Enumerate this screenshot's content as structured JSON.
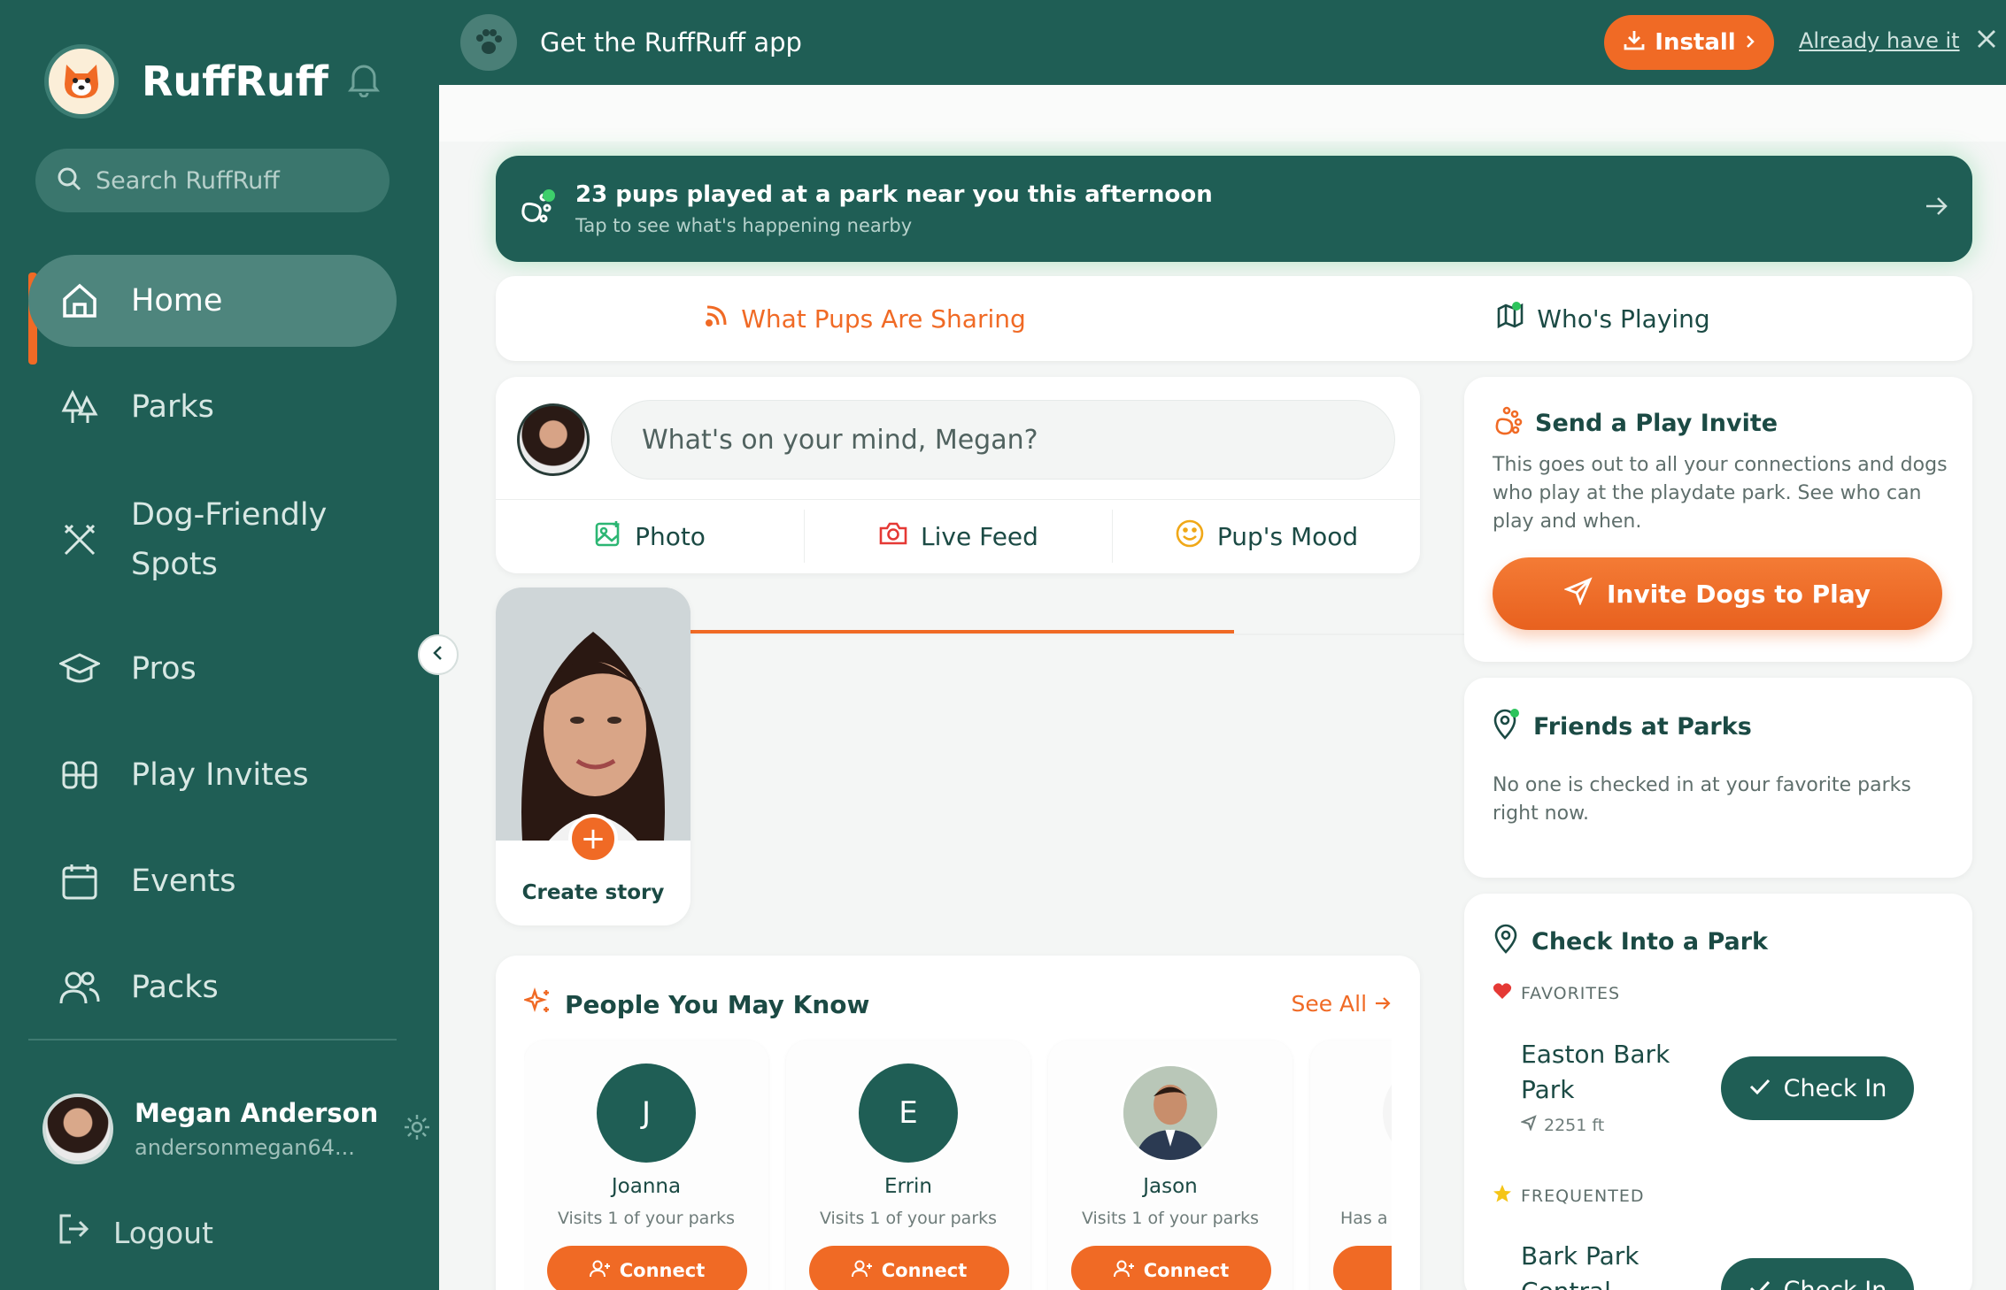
{
  "brand": {
    "name": "RuffRuff",
    "logo_icon": "dog-face-icon"
  },
  "search": {
    "placeholder": "Search RuffRuff"
  },
  "nav": [
    {
      "label": "Home",
      "icon": "home-icon",
      "active": true
    },
    {
      "label": "Parks",
      "icon": "trees-icon"
    },
    {
      "label_line1": "Dog-Friendly",
      "label_line2": "Spots",
      "icon": "utensils-icon"
    },
    {
      "label": "Pros",
      "icon": "graduation-cap-icon"
    },
    {
      "label": "Play Invites",
      "icon": "dogs-icon"
    },
    {
      "label": "Events",
      "icon": "calendar-icon"
    },
    {
      "label": "Packs",
      "icon": "users-icon"
    }
  ],
  "profile": {
    "name": "Megan Anderson",
    "email": "andersonmegan64..."
  },
  "logout_label": "Logout",
  "banner": {
    "text": "Get the RuffRuff app",
    "install": "Install",
    "already": "Already have it"
  },
  "alert": {
    "title": "23 pups played at a park near you this afternoon",
    "subtitle": "Tap to see what's happening nearby"
  },
  "tabs": {
    "sharing": "What Pups Are Sharing",
    "playing": "Who's Playing"
  },
  "composer": {
    "placeholder": "What's on your mind, Megan?",
    "photo": "Photo",
    "live": "Live Feed",
    "mood": "Pup's Mood"
  },
  "story": {
    "label": "Create story"
  },
  "pymk": {
    "title": "People You May Know",
    "see_all": "See All",
    "people": [
      {
        "initial": "J",
        "name": "Joanna",
        "sub": "Visits 1 of your parks",
        "button": "Connect"
      },
      {
        "initial": "E",
        "name": "Errin",
        "sub": "Visits 1 of your parks",
        "button": "Connect"
      },
      {
        "initial": "",
        "name": "Jason",
        "sub": "Visits 1 of your parks",
        "button": "Connect"
      },
      {
        "initial": "",
        "name": "",
        "sub": "Has a N",
        "button": ""
      }
    ]
  },
  "invite": {
    "title": "Send a Play Invite",
    "text": "This goes out to all your connections and dogs who play at the playdate park. See who can play and when.",
    "button": "Invite Dogs to Play"
  },
  "friends": {
    "title": "Friends at Parks",
    "text": "No one is checked in at your favorite parks right now."
  },
  "checkin": {
    "title": "Check Into a Park",
    "favorites_label": "FAVORITES",
    "frequented_label": "FREQUENTED",
    "parks": [
      {
        "name_line1": "Easton Bark",
        "name_line2": "Park",
        "distance": "2251 ft",
        "button": "Check In"
      },
      {
        "name_line1": "Bark Park",
        "name_line2": "Central",
        "button": "Check In"
      }
    ]
  },
  "colors": {
    "sidebar": "#1f5e55",
    "accent": "#f06a25",
    "text": "#1b4a44"
  }
}
